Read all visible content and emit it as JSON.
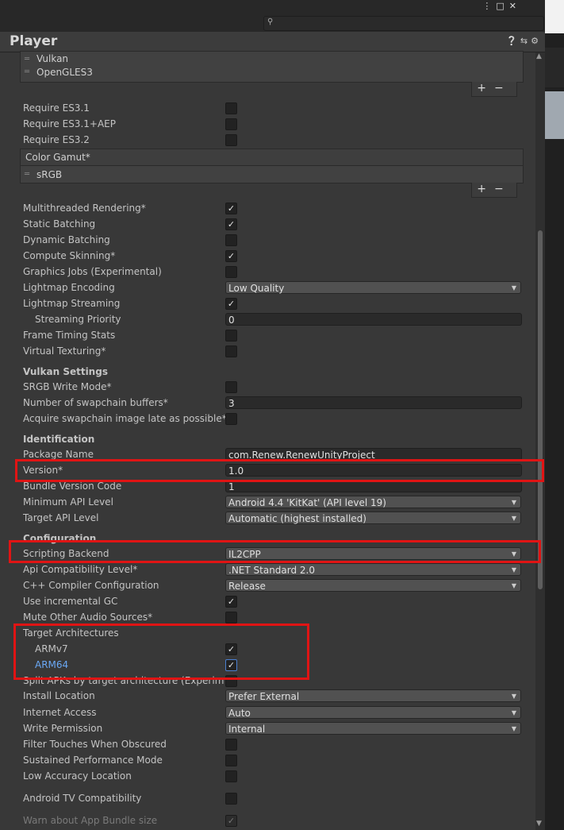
{
  "window": {
    "title": "Player",
    "search": {
      "placeholder": "",
      "icon": "search-icon"
    },
    "controls": [
      "menu-icon",
      "maximize-icon",
      "close-icon"
    ],
    "header_icons": [
      "help-icon",
      "preset-icon",
      "gear-icon"
    ]
  },
  "graphics_apis": {
    "items": [
      "Vulkan",
      "OpenGLES3"
    ],
    "add": "+",
    "remove": "−"
  },
  "require": [
    {
      "label": "Require ES3.1",
      "checked": false
    },
    {
      "label": "Require ES3.1+AEP",
      "checked": false
    },
    {
      "label": "Require ES3.2",
      "checked": false
    }
  ],
  "color_gamut": {
    "header": "Color Gamut*",
    "items": [
      "sRGB"
    ]
  },
  "rendering": {
    "multithreaded": {
      "label": "Multithreaded Rendering*",
      "checked": true
    },
    "static_batching": {
      "label": "Static Batching",
      "checked": true
    },
    "dynamic_batching": {
      "label": "Dynamic Batching",
      "checked": false
    },
    "compute_skinning": {
      "label": "Compute Skinning*",
      "checked": true
    },
    "graphics_jobs": {
      "label": "Graphics Jobs (Experimental)",
      "checked": false
    },
    "lightmap_encoding": {
      "label": "Lightmap Encoding",
      "value": "Low Quality"
    },
    "lightmap_streaming": {
      "label": "Lightmap Streaming",
      "checked": true
    },
    "streaming_priority": {
      "label": "Streaming Priority",
      "value": "0"
    },
    "frame_timing": {
      "label": "Frame Timing Stats",
      "checked": false
    },
    "virtual_texturing": {
      "label": "Virtual Texturing*",
      "checked": false
    }
  },
  "vulkan": {
    "header": "Vulkan Settings",
    "srgb_write": {
      "label": "SRGB Write Mode*",
      "checked": false
    },
    "swapchain_buffers": {
      "label": "Number of swapchain buffers*",
      "value": "3"
    },
    "acquire_late": {
      "label": "Acquire swapchain image late as possible*",
      "checked": false
    }
  },
  "identification": {
    "header": "Identification",
    "package_name": {
      "label": "Package Name",
      "value": "com.Renew.RenewUnityProject"
    },
    "version": {
      "label": "Version*",
      "value": "1.0"
    },
    "bundle_code": {
      "label": "Bundle Version Code",
      "value": "1"
    },
    "min_api": {
      "label": "Minimum API Level",
      "value": "Android 4.4 'KitKat' (API level 19)"
    },
    "target_api": {
      "label": "Target API Level",
      "value": "Automatic (highest installed)"
    }
  },
  "configuration": {
    "header": "Configuration",
    "scripting_backend": {
      "label": "Scripting Backend",
      "value": "IL2CPP"
    },
    "api_compat": {
      "label": "Api Compatibility Level*",
      "value": ".NET Standard 2.0"
    },
    "cpp_compiler": {
      "label": "C++ Compiler Configuration",
      "value": "Release"
    },
    "incremental_gc": {
      "label": "Use incremental GC",
      "checked": true
    },
    "mute_audio": {
      "label": "Mute Other Audio Sources*",
      "checked": false
    },
    "target_arch": {
      "label": "Target Architectures"
    },
    "armv7": {
      "label": "ARMv7",
      "checked": true
    },
    "arm64": {
      "label": "ARM64",
      "checked": true
    },
    "split_apks": {
      "label": "Split APKs by target architecture (Experimental)",
      "checked": false
    },
    "install_location": {
      "label": "Install Location",
      "value": "Prefer External"
    },
    "internet_access": {
      "label": "Internet Access",
      "value": "Auto"
    },
    "write_permission": {
      "label": "Write Permission",
      "value": "Internal"
    },
    "filter_touches": {
      "label": "Filter Touches When Obscured",
      "checked": false
    },
    "sustained_perf": {
      "label": "Sustained Performance Mode",
      "checked": false
    },
    "low_accuracy": {
      "label": "Low Accuracy Location",
      "checked": false
    },
    "android_tv": {
      "label": "Android TV Compatibility",
      "checked": false
    },
    "app_bundle_warn": {
      "label": "Warn about App Bundle size",
      "checked": true
    }
  },
  "colors": {
    "highlight_box": "#e01414",
    "selected_text": "#6aa8f5"
  }
}
